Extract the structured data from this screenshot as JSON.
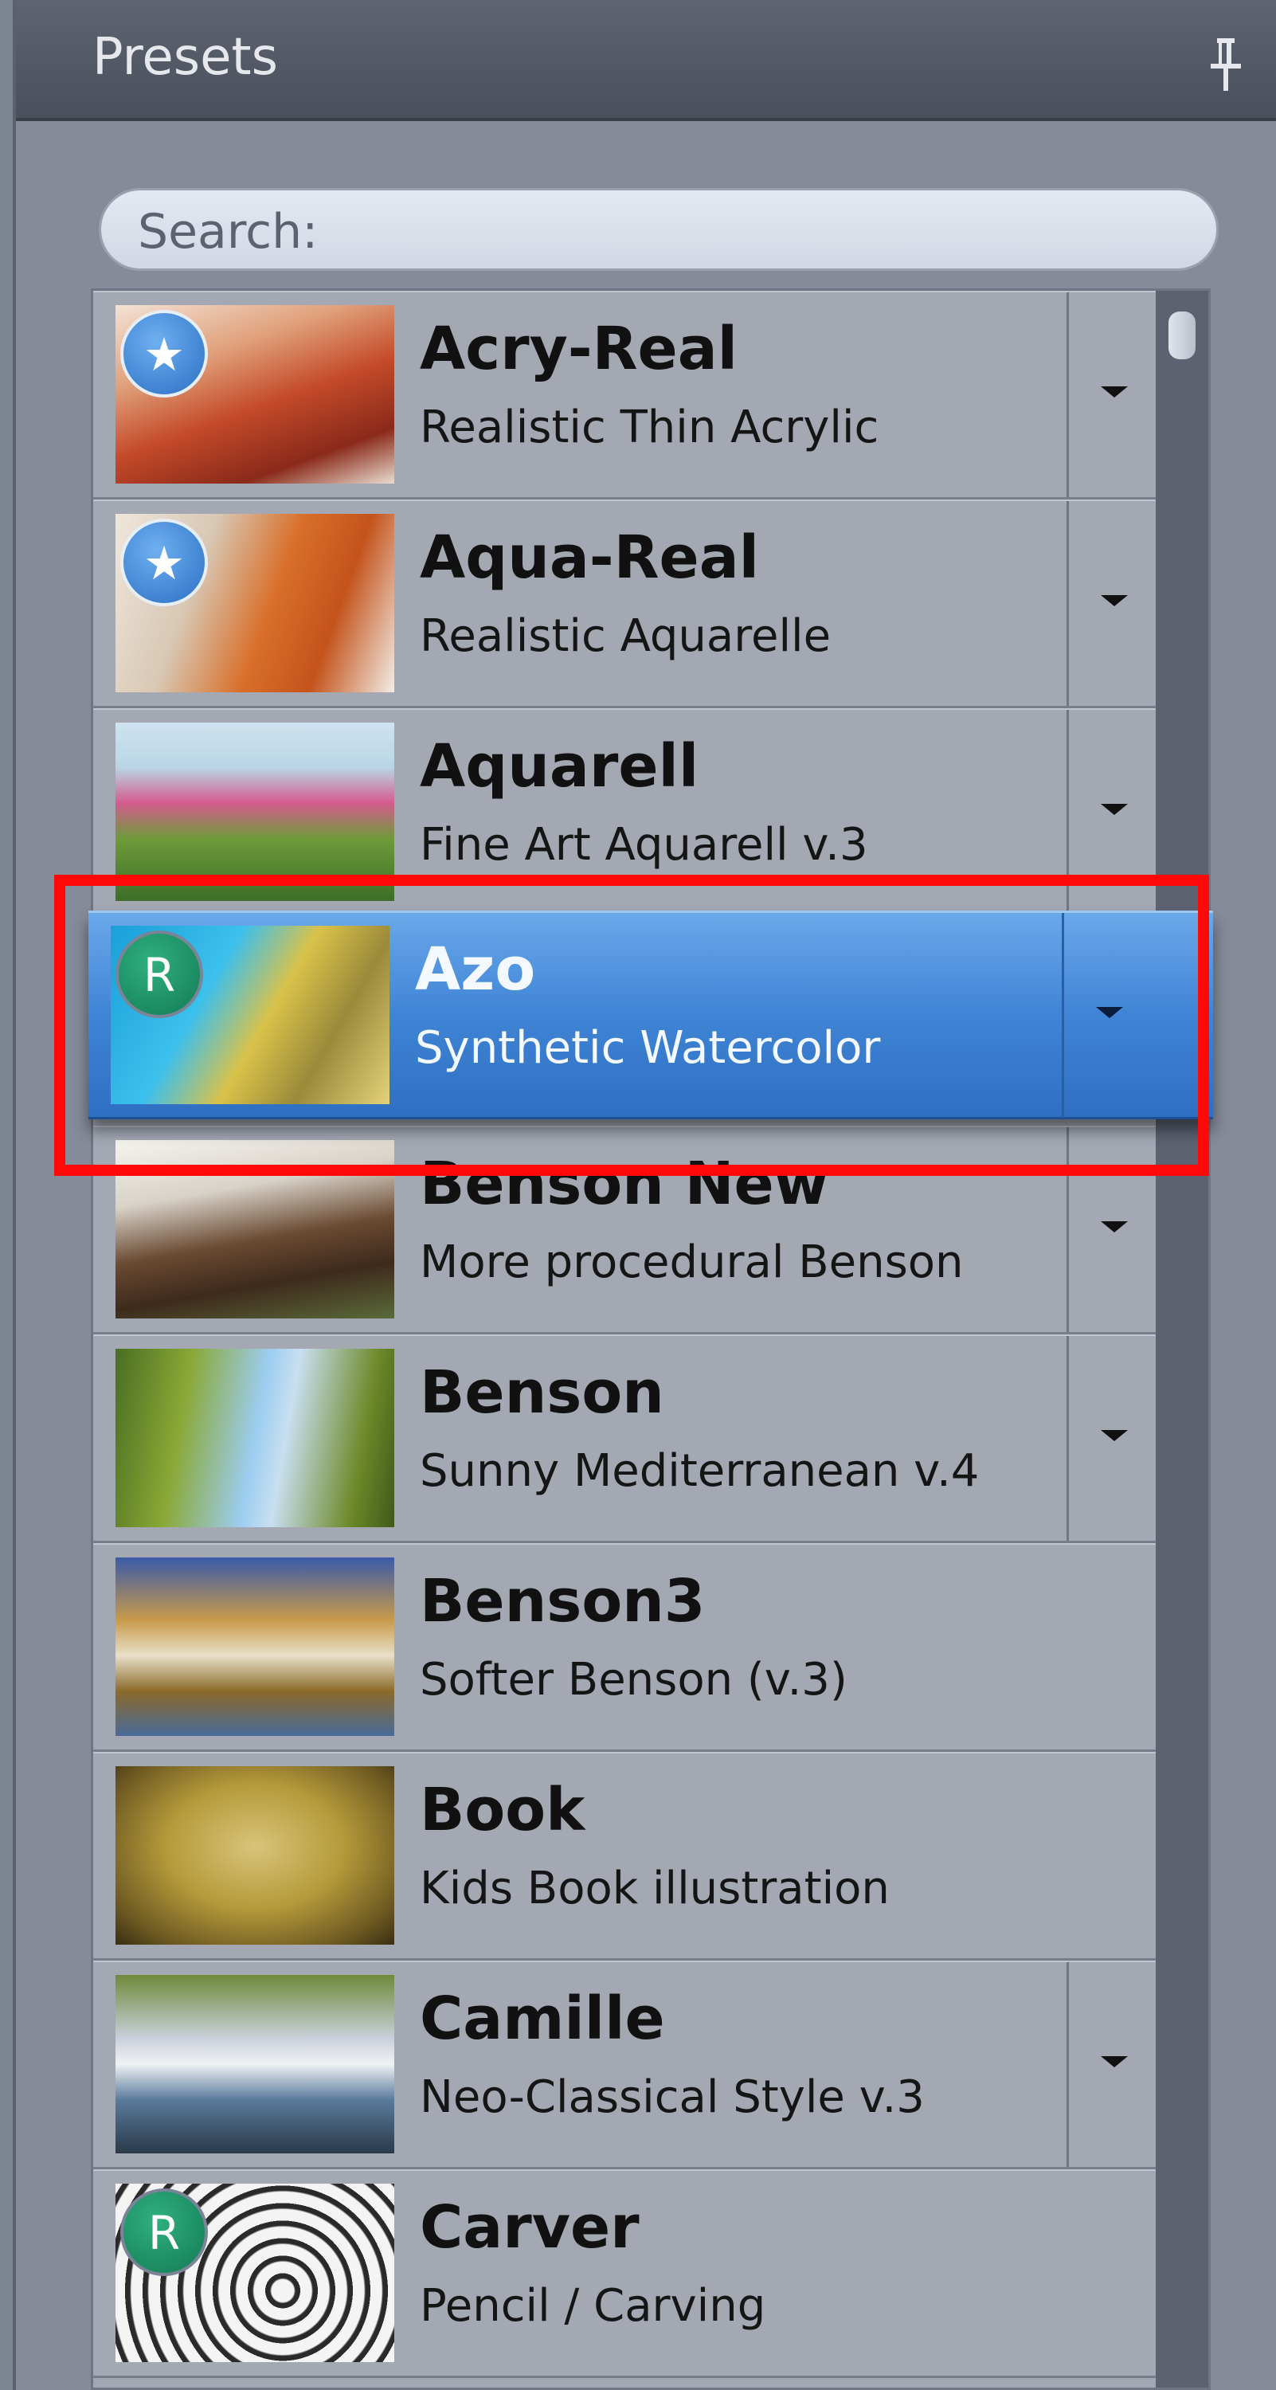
{
  "panel": {
    "title": "Presets",
    "pin_icon": "pin-icon"
  },
  "search": {
    "placeholder": "Search:"
  },
  "presets": [
    {
      "name": "Acry-Real",
      "description": "Realistic Thin Acrylic",
      "badge": "star",
      "has_dropdown": true,
      "selected": false
    },
    {
      "name": "Aqua-Real",
      "description": "Realistic Aquarelle",
      "badge": "star",
      "has_dropdown": true,
      "selected": false
    },
    {
      "name": "Aquarell",
      "description": "Fine Art Aquarell v.3",
      "badge": "",
      "has_dropdown": true,
      "selected": false
    },
    {
      "name": "Azo",
      "description": "Synthetic Watercolor",
      "badge": "R",
      "has_dropdown": true,
      "selected": true
    },
    {
      "name": "Benson New",
      "description": "More procedural Benson",
      "badge": "",
      "has_dropdown": true,
      "selected": false
    },
    {
      "name": "Benson",
      "description": "Sunny Mediterranean v.4",
      "badge": "",
      "has_dropdown": true,
      "selected": false
    },
    {
      "name": "Benson3",
      "description": "Softer Benson (v.3)",
      "badge": "",
      "has_dropdown": false,
      "selected": false
    },
    {
      "name": "Book",
      "description": "Kids Book illustration",
      "badge": "",
      "has_dropdown": false,
      "selected": false
    },
    {
      "name": "Camille",
      "description": "Neo-Classical Style v.3",
      "badge": "",
      "has_dropdown": true,
      "selected": false
    },
    {
      "name": "Carver",
      "description": "Pencil / Carving",
      "badge": "R",
      "has_dropdown": false,
      "selected": false
    }
  ],
  "colors": {
    "selection": "#3f84d5",
    "highlight_box": "#ff0808",
    "badge_star": "#2a6fc4",
    "badge_r": "#137a55"
  }
}
